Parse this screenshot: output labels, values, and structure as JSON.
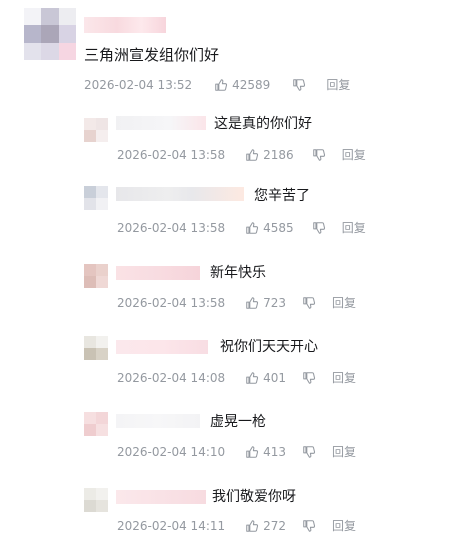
{
  "root": {
    "text": "三角洲宣发组你们好",
    "time": "2026-02-04 13:52",
    "likes": "42589",
    "reply_label": "回复"
  },
  "replies": [
    {
      "text": "这是真的你们好",
      "time": "2026-02-04 13:58",
      "likes": "2186",
      "reply_label": "回复"
    },
    {
      "text": "您辛苦了",
      "time": "2026-02-04 13:58",
      "likes": "4585",
      "reply_label": "回复"
    },
    {
      "text": "新年快乐",
      "time": "2026-02-04 13:58",
      "likes": "723",
      "reply_label": "回复"
    },
    {
      "text": "祝你们天天开心",
      "time": "2026-02-04 14:08",
      "likes": "401",
      "reply_label": "回复"
    },
    {
      "text": "虚晃一枪",
      "time": "2026-02-04 14:10",
      "likes": "413",
      "reply_label": "回复"
    },
    {
      "text": "我们敬爱你呀",
      "time": "2026-02-04 14:11",
      "likes": "272",
      "reply_label": "回复"
    }
  ],
  "icons": {
    "like": "thumbs-up-icon",
    "dislike": "thumbs-down-icon"
  },
  "colors": {
    "meta_text": "#9499a0",
    "body_text": "#18191c"
  }
}
